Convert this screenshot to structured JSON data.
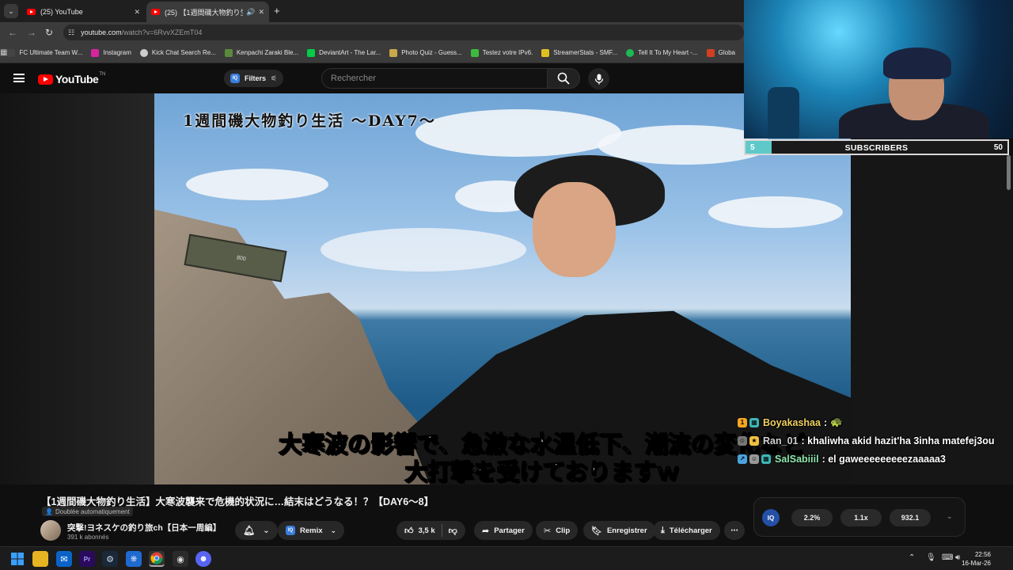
{
  "browser": {
    "tabs": [
      {
        "title": "(25) YouTube",
        "active": false
      },
      {
        "title": "(25) 【1週間磯大物釣り生活】",
        "active": true
      }
    ],
    "url_host": "youtube.com",
    "url_path": "/watch?v=6RvvXZEmT04",
    "bookmarks": [
      {
        "label": "FC Ultimate Team W...",
        "color": "#444"
      },
      {
        "label": "Instagram",
        "color": "#d6249f"
      },
      {
        "label": "Kick Chat Search Re...",
        "color": "#ccc"
      },
      {
        "label": "Kenpachi Zaraki Ble...",
        "color": "#5a8a3a"
      },
      {
        "label": "DeviantArt - The Lar...",
        "color": "#05cc47"
      },
      {
        "label": "Photo Quiz - Guess...",
        "color": "#c8a84a"
      },
      {
        "label": "Testez votre IPv6.",
        "color": "#3dbb3d"
      },
      {
        "label": "StreamerStats - SMF...",
        "color": "#e0c020"
      },
      {
        "label": "Tell It To My Heart -...",
        "color": "#1db954"
      },
      {
        "label": "Globa",
        "color": "#d04020"
      }
    ]
  },
  "youtube": {
    "logo_text": "YouTube",
    "logo_suffix": "TN",
    "filters_label": "Filters",
    "search_placeholder": "Rechercher"
  },
  "video": {
    "overlay_title": "1週間磯大物釣り生活 ～DAY7～",
    "case_text": "800",
    "subtitle_line1": "大寒波の影響で、急激な水温低下、潮流の変化など",
    "subtitle_line2": "大打撃を受けておりますｗ"
  },
  "below": {
    "title": "【1週間磯大物釣り生活】大寒波襲来で危機的状況に…結末はどうなる！？【DAY6〜8】",
    "dub_label": "Doublée automatiquement",
    "channel_name": "突撃!ヨネスケの釣り旅ch【日本一周編】",
    "subscribers": "391 k abonnés",
    "remix_label": "Remix",
    "likes": "3,5 k",
    "share_label": "Partager",
    "clip_label": "Clip",
    "save_label": "Enregistrer",
    "download_label": "Télécharger",
    "iq": {
      "badge": "IQ",
      "stats": [
        "2.2%",
        "1.1x",
        "932.1"
      ]
    }
  },
  "overlay": {
    "sub_goal": {
      "current": "5",
      "label": "SUBSCRIBERS",
      "goal": "50",
      "progress": 0.1
    },
    "chat": [
      {
        "user": "Boyakashaa",
        "message": "",
        "color": "#f0d060",
        "badges": [
          "#f5a623",
          "#3fb6b6"
        ]
      },
      {
        "user": "Ran_01",
        "message": ": khaliwha akid hazit'ha 3inha matefej3ou",
        "color": "#d0d0d0",
        "badges": [
          "#777",
          "#f0c040"
        ]
      },
      {
        "user": "SalSabiiil",
        "message": ": el gaweeeeeeeeezaaaaa3",
        "color": "#8fe8b0",
        "badges": [
          "#4aa3df",
          "#999",
          "#3fb6b6"
        ]
      }
    ]
  },
  "taskbar": {
    "time": "22:56",
    "date": "16-Mar-26"
  }
}
